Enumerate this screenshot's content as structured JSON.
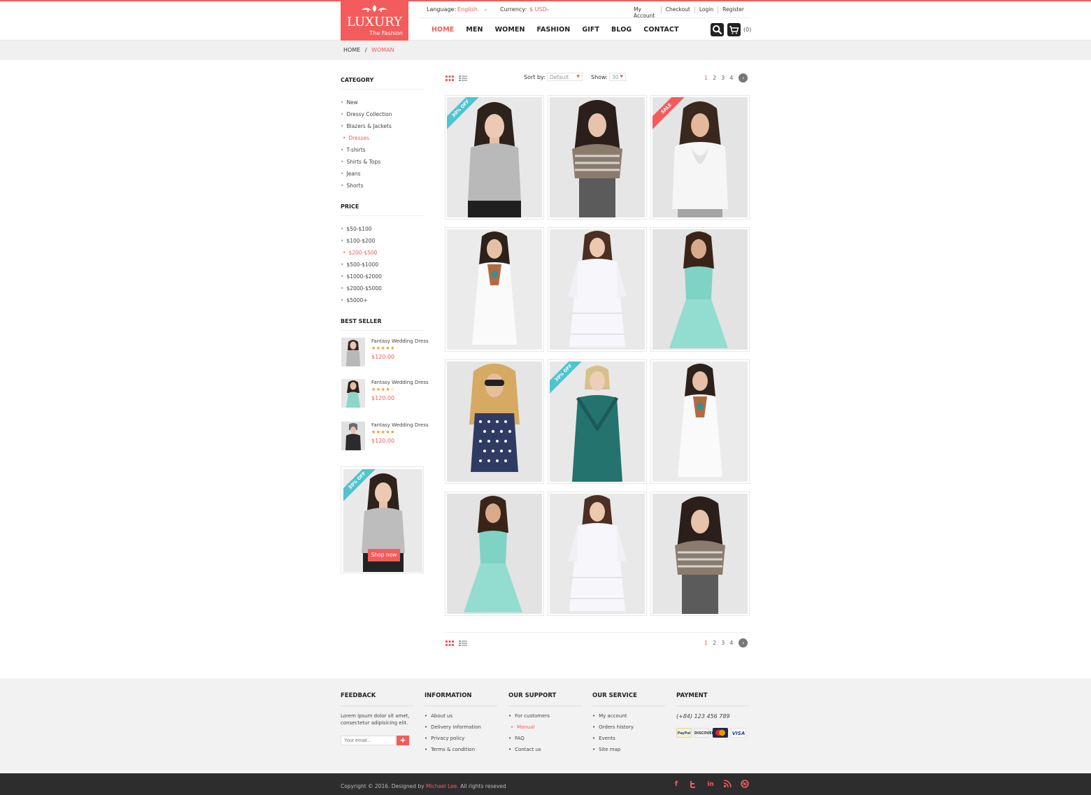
{
  "colors": {
    "accent": "#f25c5c",
    "teal": "#4fc4cf",
    "dark": "#222222",
    "footer_bg": "#f2f2f2",
    "bottom_bar": "#2d2d2d"
  },
  "logo": {
    "name": "LUXURY",
    "tagline": "The Fashion"
  },
  "topbar": {
    "language_label": "Language:",
    "language_value": "English",
    "currency_label": "Currency:",
    "currency_value": "$ USD",
    "links": [
      "My Account",
      "Checkout",
      "Login",
      "Register"
    ]
  },
  "nav": {
    "items": [
      "HOME",
      "MEN",
      "WOMEN",
      "FASHION",
      "GIFT",
      "BLOG",
      "CONTACT"
    ],
    "cart_count": "(0)"
  },
  "icons": {
    "search": "search-icon",
    "cart": "cart-icon",
    "grid": "grid-view-icon",
    "list": "list-view-icon",
    "next": "chevron-right-icon"
  },
  "breadcrumb": {
    "home": "HOME",
    "separator": "/",
    "current": "WOMAN"
  },
  "sidebar": {
    "category_title": "CATEGORY",
    "categories": [
      "New",
      "Dressy Collection",
      "Blazers & Jackets",
      "Dresses",
      "T-shirts",
      "Shirts & Tops",
      "Jeans",
      "Shorts"
    ],
    "price_title": "PRICE",
    "prices": [
      "$50-$100",
      "$100-$200",
      "$200-$500",
      "$500-$1000",
      "$1000-$2000",
      "$2000-$5000",
      "$5000+"
    ],
    "bestseller_title": "BEST SELLER",
    "bestsellers": [
      {
        "name": "Fantasy Wedding Dress",
        "rating": 5,
        "stars": "★★★★★",
        "price": "$120.00"
      },
      {
        "name": "Fantasy Wedding Dress",
        "rating": 4,
        "stars": "★★★★☆",
        "price": "$120.00"
      },
      {
        "name": "Fantasy Wedding Dress",
        "rating": 5,
        "stars": "★★★★★",
        "price": "$120.00"
      }
    ],
    "promo_badge": "30% OFF",
    "promo_button": "Shop now"
  },
  "toolbar": {
    "sort_label": "Sort by:",
    "sort_value": "Default",
    "show_label": "Show:",
    "show_value": "30",
    "pages": [
      "1",
      "2",
      "3",
      "4"
    ],
    "current_page": "1"
  },
  "products": [
    {
      "badge": "30% OFF",
      "badge_color": "#4fc4cf",
      "outfit": "grey-top"
    },
    {
      "badge": "",
      "outfit": "striped-top"
    },
    {
      "badge": "SALE",
      "badge_color": "#f25c5c",
      "outfit": "white-blouse"
    },
    {
      "badge": "",
      "outfit": "white-dress"
    },
    {
      "badge": "",
      "outfit": "white-lace-dress"
    },
    {
      "badge": "",
      "outfit": "mint-dress"
    },
    {
      "badge": "",
      "outfit": "polka-dress"
    },
    {
      "badge": "30% OFF",
      "badge_color": "#4fc4cf",
      "outfit": "teal-dress"
    },
    {
      "badge": "",
      "outfit": "white-dress"
    },
    {
      "badge": "",
      "outfit": "mint-dress"
    },
    {
      "badge": "",
      "outfit": "white-lace-dress"
    },
    {
      "badge": "",
      "outfit": "striped-top"
    }
  ],
  "footer": {
    "feedback": {
      "title": "FEEDBACK",
      "text": "Lorem ipsum dolor sit amet, consectetur adipisicing elit.",
      "email_placeholder": "Your email...",
      "submit": "+"
    },
    "information": {
      "title": "INFORMATION",
      "items": [
        "About us",
        "Delivery information",
        "Privacy policy",
        "Terms & condition"
      ]
    },
    "support": {
      "title": "OUR SUPPORT",
      "items": [
        "For customers",
        "Manual",
        "FAQ",
        "Contact us"
      ]
    },
    "service": {
      "title": "OUR SERVICE",
      "items": [
        "My account",
        "Orders history",
        "Events",
        "Site map"
      ]
    },
    "payment": {
      "title": "PAYMENT",
      "phone": "(+84) 123 456 789",
      "cards": [
        "PayPal",
        "DISCOVER",
        "MC",
        "VISA"
      ]
    }
  },
  "bottom": {
    "copyright_pre": "Copyright © 2016. Designed by",
    "author": "Michael Lee.",
    "copyright_post": "All rights reseved",
    "social": [
      "facebook-icon",
      "twitter-icon",
      "linkedin-icon",
      "rss-icon",
      "dribbble-icon"
    ]
  }
}
